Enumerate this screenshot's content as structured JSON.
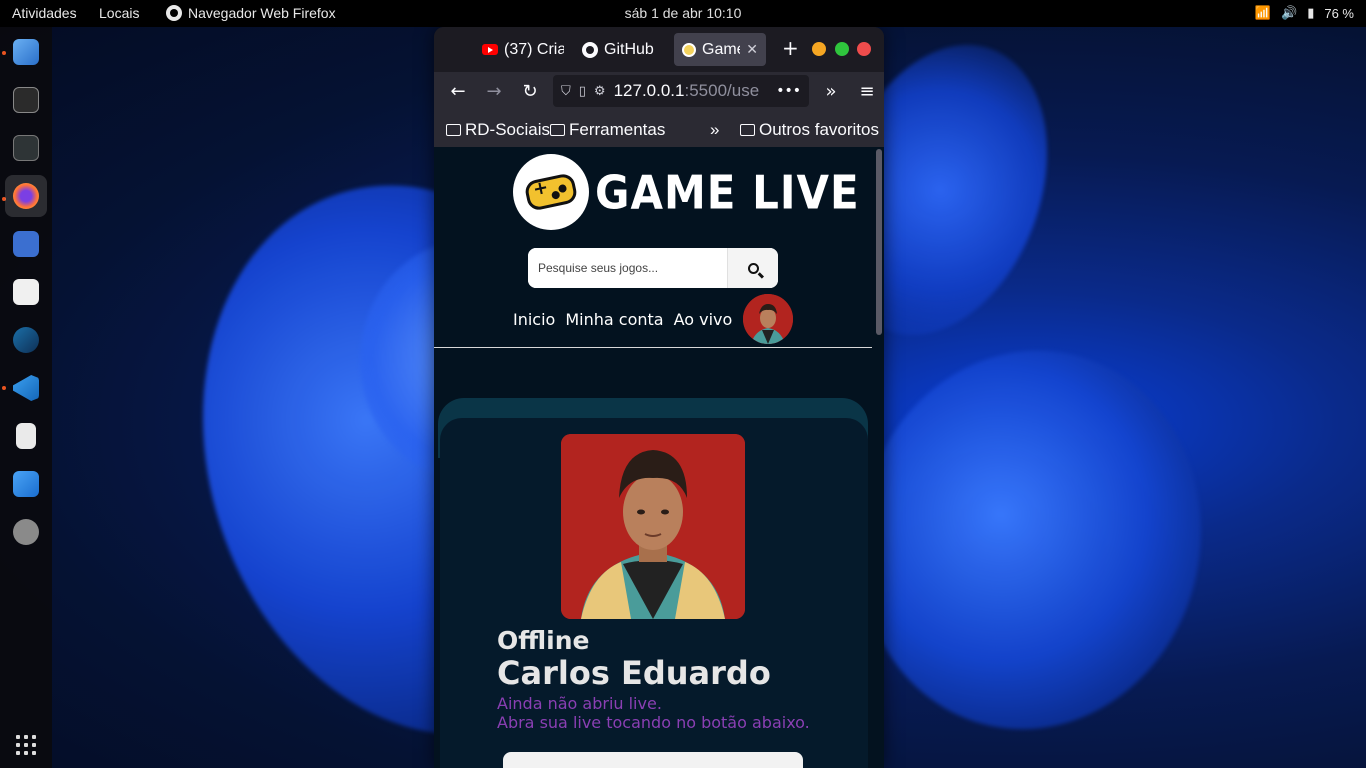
{
  "topbar": {
    "activities": "Atividades",
    "places": "Locais",
    "app_name": "Navegador Web Firefox",
    "clock": "sáb 1 de abr  10:10",
    "battery": "76 %"
  },
  "dock": {
    "items": [
      "files-icon",
      "terminal-icon",
      "system-monitor-icon",
      "firefox-icon",
      "calculator-icon",
      "text-editor-icon",
      "steam-icon",
      "vscode-icon",
      "solitaire-icon",
      "software-updater-icon",
      "settings-icon"
    ]
  },
  "browser": {
    "tabs": [
      {
        "label": "(37) Cria",
        "icon": "youtube-icon"
      },
      {
        "label": "GitHub",
        "icon": "github-icon"
      },
      {
        "label": "Game",
        "icon": "game-live-icon",
        "active": true
      }
    ],
    "url_host": "127.0.0.1",
    "url_path": ":5500/use",
    "bookmarks": [
      "RD-Sociais",
      "Ferramentas"
    ],
    "other_bookmarks": "Outros favoritos"
  },
  "site": {
    "logo_text": "GAME LIVE",
    "search_placeholder": "Pesquise seus jogos...",
    "nav": [
      "Inicio",
      "Minha conta",
      "Ao vivo"
    ],
    "profile": {
      "status": "Offline",
      "name": "Carlos Eduardo",
      "message_line1": "Ainda não abriu live.",
      "message_line2": "Abra sua live tocando no botão abaixo."
    },
    "colors": {
      "page_bg": "#03121f",
      "message": "#8a3fb3",
      "avatar_bg": "#b2241f"
    }
  }
}
